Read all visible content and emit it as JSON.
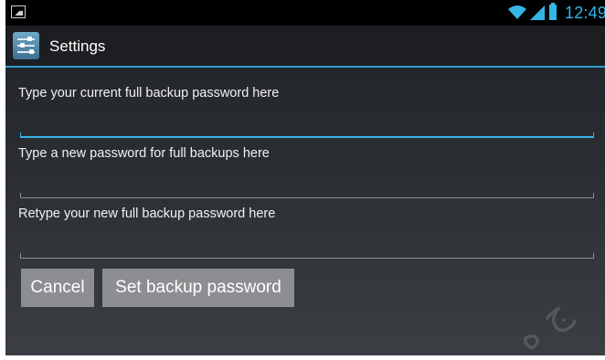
{
  "status_bar": {
    "time": "12:49",
    "accent_color": "#35b5e5"
  },
  "action_bar": {
    "title": "Settings",
    "icon": "settings-app-icon"
  },
  "form": {
    "current_password_label": "Type your current full backup password here",
    "new_password_label": "Type a new password for full backups here",
    "retype_password_label": "Retype your new full backup password here"
  },
  "buttons": {
    "cancel": "Cancel",
    "set_backup_password": "Set backup password"
  },
  "watermark": "ج ه"
}
